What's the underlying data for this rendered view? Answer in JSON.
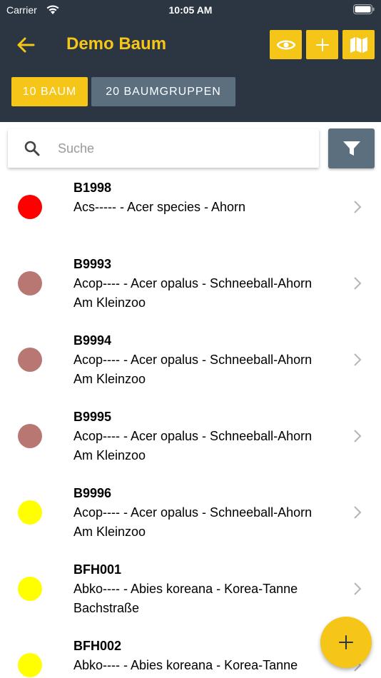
{
  "status_bar": {
    "carrier": "Carrier",
    "time": "10:05 AM"
  },
  "header": {
    "title": "Demo Baum",
    "back_icon": "arrow-left-icon",
    "actions": [
      {
        "icon": "eye-icon"
      },
      {
        "icon": "plus-icon"
      },
      {
        "icon": "map-icon"
      }
    ]
  },
  "tabs": [
    {
      "label": "10 BAUM",
      "active": true
    },
    {
      "label": "20 BAUMGRUPPEN",
      "active": false
    }
  ],
  "search": {
    "placeholder": "Suche",
    "value": ""
  },
  "filter": {
    "icon": "filter-icon"
  },
  "trees": [
    {
      "id": "B1998",
      "species": "Acs----- - Acer species - Ahorn",
      "location": "",
      "color": "#ff0000"
    },
    {
      "id": "B9993",
      "species": "Acop---- - Acer opalus - Schneeball-Ahorn",
      "location": "Am Kleinzoo",
      "color": "#b87773"
    },
    {
      "id": "B9994",
      "species": "Acop---- - Acer opalus - Schneeball-Ahorn",
      "location": "Am Kleinzoo",
      "color": "#b87773"
    },
    {
      "id": "B9995",
      "species": "Acop---- - Acer opalus - Schneeball-Ahorn",
      "location": "Am Kleinzoo",
      "color": "#b87773"
    },
    {
      "id": "B9996",
      "species": "Acop---- - Acer opalus - Schneeball-Ahorn",
      "location": "Am Kleinzoo",
      "color": "#ffff00"
    },
    {
      "id": "BFH001",
      "species": "Abko---- - Abies koreana - Korea-Tanne",
      "location": "Bachstraße",
      "color": "#ffff00"
    },
    {
      "id": "BFH002",
      "species": "Abko---- - Abies koreana - Korea-Tanne",
      "location": "",
      "color": "#ffff00"
    }
  ],
  "fab": {
    "icon": "plus-icon"
  },
  "colors": {
    "header_bg": "#2b3642",
    "accent": "#f5c518",
    "secondary": "#5b6f7f"
  }
}
